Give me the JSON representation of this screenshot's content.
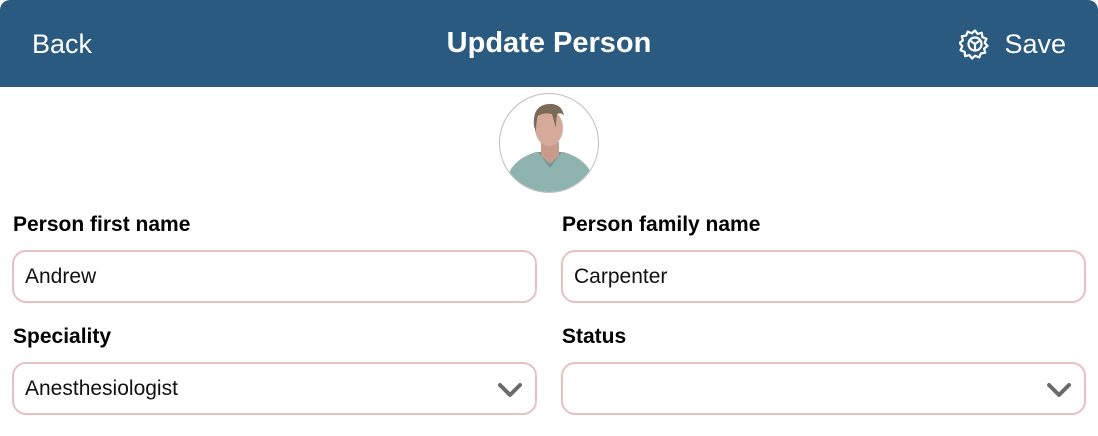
{
  "header": {
    "back_label": "Back",
    "title": "Update Person",
    "save_label": "Save",
    "save_icon": "gear-icon",
    "background": "#2b5a80"
  },
  "avatar": {
    "icon": "person-avatar"
  },
  "form": {
    "first_name": {
      "label": "Person first name",
      "value": "Andrew"
    },
    "family_name": {
      "label": "Person family name",
      "value": "Carpenter"
    },
    "speciality": {
      "label": "Speciality",
      "value": "Anesthesiologist",
      "icon": "chevron-down-icon"
    },
    "status": {
      "label": "Status",
      "value": "",
      "icon": "chevron-down-icon"
    },
    "field_border_color": "#e8c0c0"
  }
}
